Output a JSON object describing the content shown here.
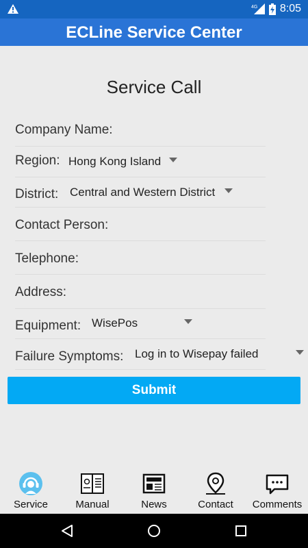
{
  "status_bar": {
    "network": "4G",
    "time": "8:05"
  },
  "app": {
    "title": "ECLine Service Center"
  },
  "page_title": "Service Call",
  "form": {
    "company_label": "Company Name:",
    "region_label": "Region:",
    "region_value": "Hong Kong Island",
    "district_label": "District:",
    "district_value": "Central and Western District",
    "contact_label": "Contact Person:",
    "telephone_label": "Telephone:",
    "address_label": "Address:",
    "equipment_label": "Equipment:",
    "equipment_value": "WisePos",
    "failure_label": "Failure Symptoms:",
    "failure_value": "Log in to Wisepay failed"
  },
  "submit_label": "Submit",
  "tabs": [
    "Service",
    "Manual",
    "News",
    "Contact",
    "Comments"
  ],
  "colors": {
    "appbar": "#2a74d6",
    "submit": "#03a9f4"
  }
}
